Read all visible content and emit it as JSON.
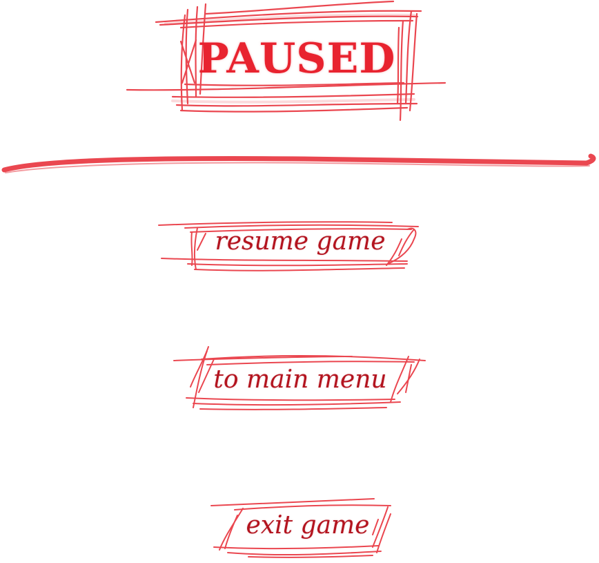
{
  "pause_menu": {
    "title": "PAUSED",
    "buttons": {
      "resume": "resume game",
      "main_menu": "to main menu",
      "exit": "exit game"
    }
  },
  "colors": {
    "scribble": "#e8333d",
    "title": "#e8232f",
    "button_text": "#b3141f",
    "background": "#ffffff"
  }
}
